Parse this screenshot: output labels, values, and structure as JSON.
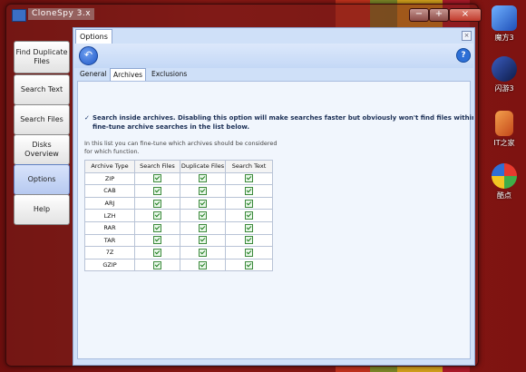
{
  "window": {
    "title": "CloneSpy 3.x",
    "buttons": {
      "minimize": "−",
      "maximize": "+",
      "close": "×"
    }
  },
  "sidebar": {
    "items": [
      {
        "label": "Find Duplicate Files"
      },
      {
        "label": "Search Text"
      },
      {
        "label": "Search Files"
      },
      {
        "label": "Disks Overview"
      },
      {
        "label": "Options"
      },
      {
        "label": "Help"
      }
    ],
    "active": "Options"
  },
  "panel": {
    "tab_label": "Options",
    "close_glyph": "×",
    "back_glyph": "↶",
    "help_glyph": "?",
    "subtabs": [
      "General",
      "Archives",
      "Exclusions"
    ],
    "active_subtab": "Archives"
  },
  "archives": {
    "search_inside": {
      "checked": true,
      "line1": "Search inside archives.  Disabling this option will make searches faster but obviously won't find files within archives",
      "line2": "fine-tune archive searches in the list below."
    },
    "note_line1": "In this list you can fine-tune which archives should be considered",
    "note_line2": "for which function.",
    "columns": [
      "Archive Type",
      "Search Files",
      "Duplicate Files",
      "Search Text"
    ],
    "rows": [
      {
        "type": "ZIP",
        "search_files": true,
        "duplicate_files": true,
        "search_text": true
      },
      {
        "type": "CAB",
        "search_files": true,
        "duplicate_files": true,
        "search_text": true
      },
      {
        "type": "ARJ",
        "search_files": true,
        "duplicate_files": true,
        "search_text": true
      },
      {
        "type": "LZH",
        "search_files": true,
        "duplicate_files": true,
        "search_text": true
      },
      {
        "type": "RAR",
        "search_files": true,
        "duplicate_files": true,
        "search_text": true
      },
      {
        "type": "TAR",
        "search_files": true,
        "duplicate_files": true,
        "search_text": true
      },
      {
        "type": "7Z",
        "search_files": true,
        "duplicate_files": true,
        "search_text": true
      },
      {
        "type": "GZIP",
        "search_files": true,
        "duplicate_files": true,
        "search_text": true
      }
    ]
  },
  "desktop": {
    "icons": [
      {
        "label": "魔方3",
        "icon": "magic-cube-icon",
        "color": "#3a7bd5"
      },
      {
        "label": "闪游3",
        "icon": "rocket-icon",
        "color": "#1d2f6b"
      },
      {
        "label": "IT之家",
        "icon": "it-home-icon",
        "color": "#e8742a"
      },
      {
        "label": "酷点",
        "icon": "hexagon-cluster-icon",
        "color": "#f2b632"
      }
    ]
  },
  "colors": {
    "stripe_red": "#c2231f",
    "stripe_green": "#7a9a2c",
    "stripe_yellow": "#e0b81e",
    "stripe_crimson": "#b31b2e"
  }
}
